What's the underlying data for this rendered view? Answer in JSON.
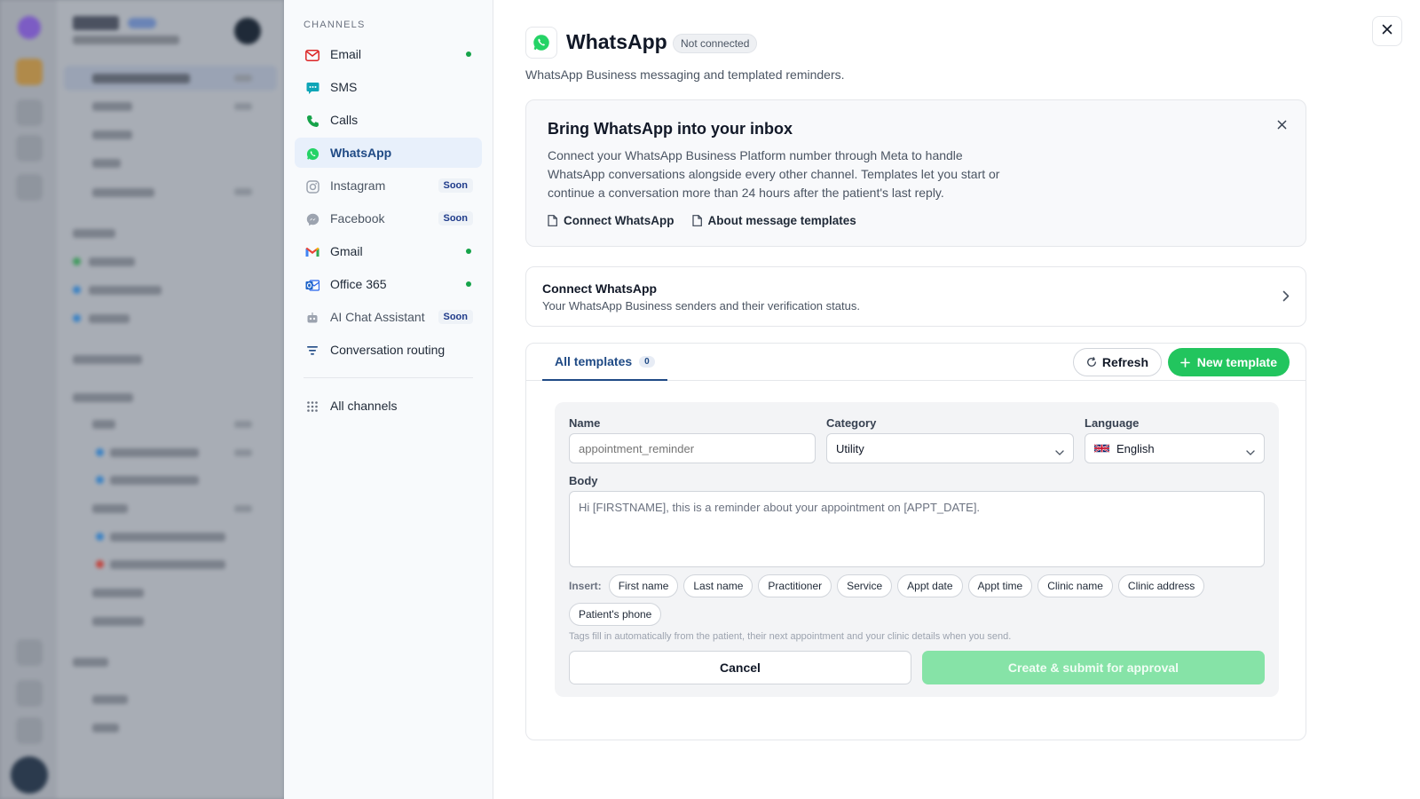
{
  "channels": {
    "heading": "CHANNELS",
    "items": [
      {
        "label": "Email",
        "icon": "mail-icon",
        "status": "connected"
      },
      {
        "label": "SMS",
        "icon": "sms-icon"
      },
      {
        "label": "Calls",
        "icon": "phone-icon"
      },
      {
        "label": "WhatsApp",
        "icon": "whatsapp-icon",
        "active": true
      },
      {
        "label": "Instagram",
        "icon": "instagram-icon",
        "badge": "Soon"
      },
      {
        "label": "Facebook",
        "icon": "messenger-icon",
        "badge": "Soon"
      },
      {
        "label": "Gmail",
        "icon": "gmail-icon",
        "status": "connected"
      },
      {
        "label": "Office 365",
        "icon": "outlook-icon",
        "status": "connected"
      },
      {
        "label": "AI Chat Assistant",
        "icon": "robot-icon",
        "badge": "Soon"
      },
      {
        "label": "Conversation routing",
        "icon": "filter-icon"
      }
    ],
    "all_channels": "All channels"
  },
  "header": {
    "title": "WhatsApp",
    "status_badge": "Not connected",
    "subtitle": "WhatsApp Business messaging and templated reminders."
  },
  "promo": {
    "title": "Bring WhatsApp into your inbox",
    "body": "Connect your WhatsApp Business Platform number through Meta to handle WhatsApp conversations alongside every other channel. Templates let you start or continue a conversation more than 24 hours after the patient's last reply.",
    "link_connect": "Connect WhatsApp",
    "link_templates": "About message templates"
  },
  "connect_card": {
    "title": "Connect WhatsApp",
    "subtitle": "Your WhatsApp Business senders and their verification status."
  },
  "templates": {
    "tab_label": "All templates",
    "tab_count": "0",
    "refresh_label": "Refresh",
    "new_label": "New template",
    "form": {
      "name_label": "Name",
      "name_placeholder": "appointment_reminder",
      "category_label": "Category",
      "category_value": "Utility",
      "language_label": "Language",
      "language_value": "English",
      "body_label": "Body",
      "body_placeholder": "Hi [FIRSTNAME], this is a reminder about your appointment on [APPT_DATE].",
      "insert_label": "Insert:",
      "insert_tags": [
        "First name",
        "Last name",
        "Practitioner",
        "Service",
        "Appt date",
        "Appt time",
        "Clinic name",
        "Clinic address",
        "Patient's phone"
      ],
      "hint": "Tags fill in automatically from the patient, their next appointment and your clinic details when you send.",
      "cancel_label": "Cancel",
      "submit_label": "Create & submit for approval"
    }
  },
  "colors": {
    "whatsapp_green": "#25d366",
    "primary_green": "#22c55e",
    "active_blue": "#1f4a85",
    "status_dot": "#16a34a"
  }
}
